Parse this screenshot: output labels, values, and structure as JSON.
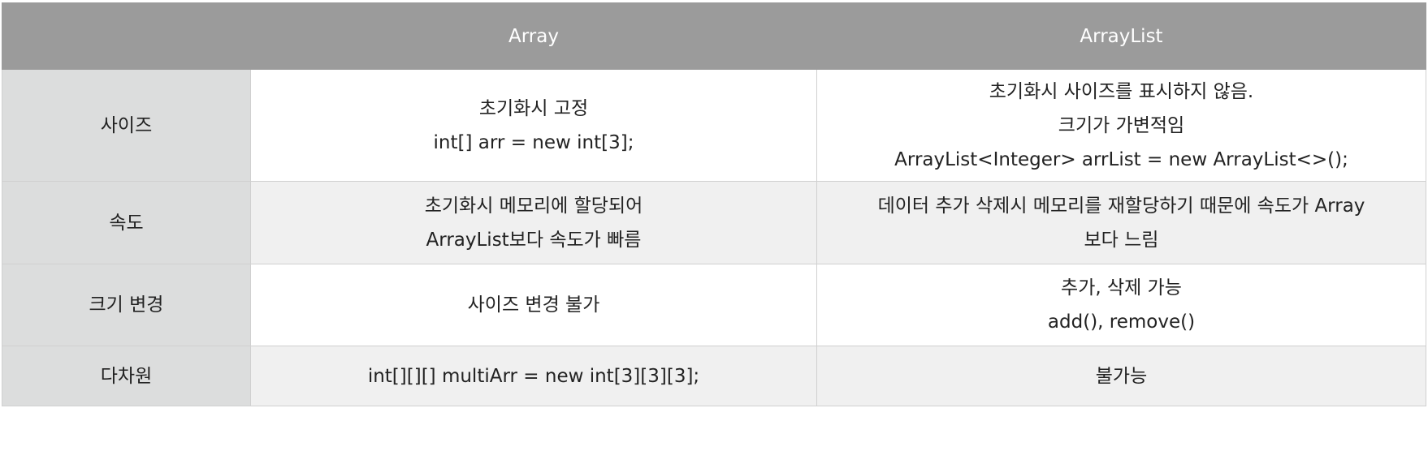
{
  "table": {
    "headers": [
      "",
      "Array",
      "ArrayList"
    ],
    "rows": [
      {
        "label": "사이즈",
        "array": [
          "초기화시 고정",
          "int[] arr = new int[3];"
        ],
        "arraylist": [
          "초기화시 사이즈를 표시하지 않음.",
          "크기가 가변적임",
          "ArrayList<Integer> arrList = new ArrayList<>();"
        ]
      },
      {
        "label": "속도",
        "array": [
          "초기화시 메모리에 할당되어",
          "ArrayList보다 속도가 빠름"
        ],
        "arraylist": [
          "데이터 추가 삭제시 메모리를 재할당하기 때문에 속도가 Array",
          "보다 느림"
        ]
      },
      {
        "label": "크기 변경",
        "array": [
          "사이즈 변경 불가"
        ],
        "arraylist": [
          "추가, 삭제 가능",
          "add(), remove()"
        ]
      },
      {
        "label": "다차원",
        "array": [
          "int[][][] multiArr = new int[3][3][3];"
        ],
        "arraylist": [
          "불가능"
        ]
      }
    ]
  }
}
